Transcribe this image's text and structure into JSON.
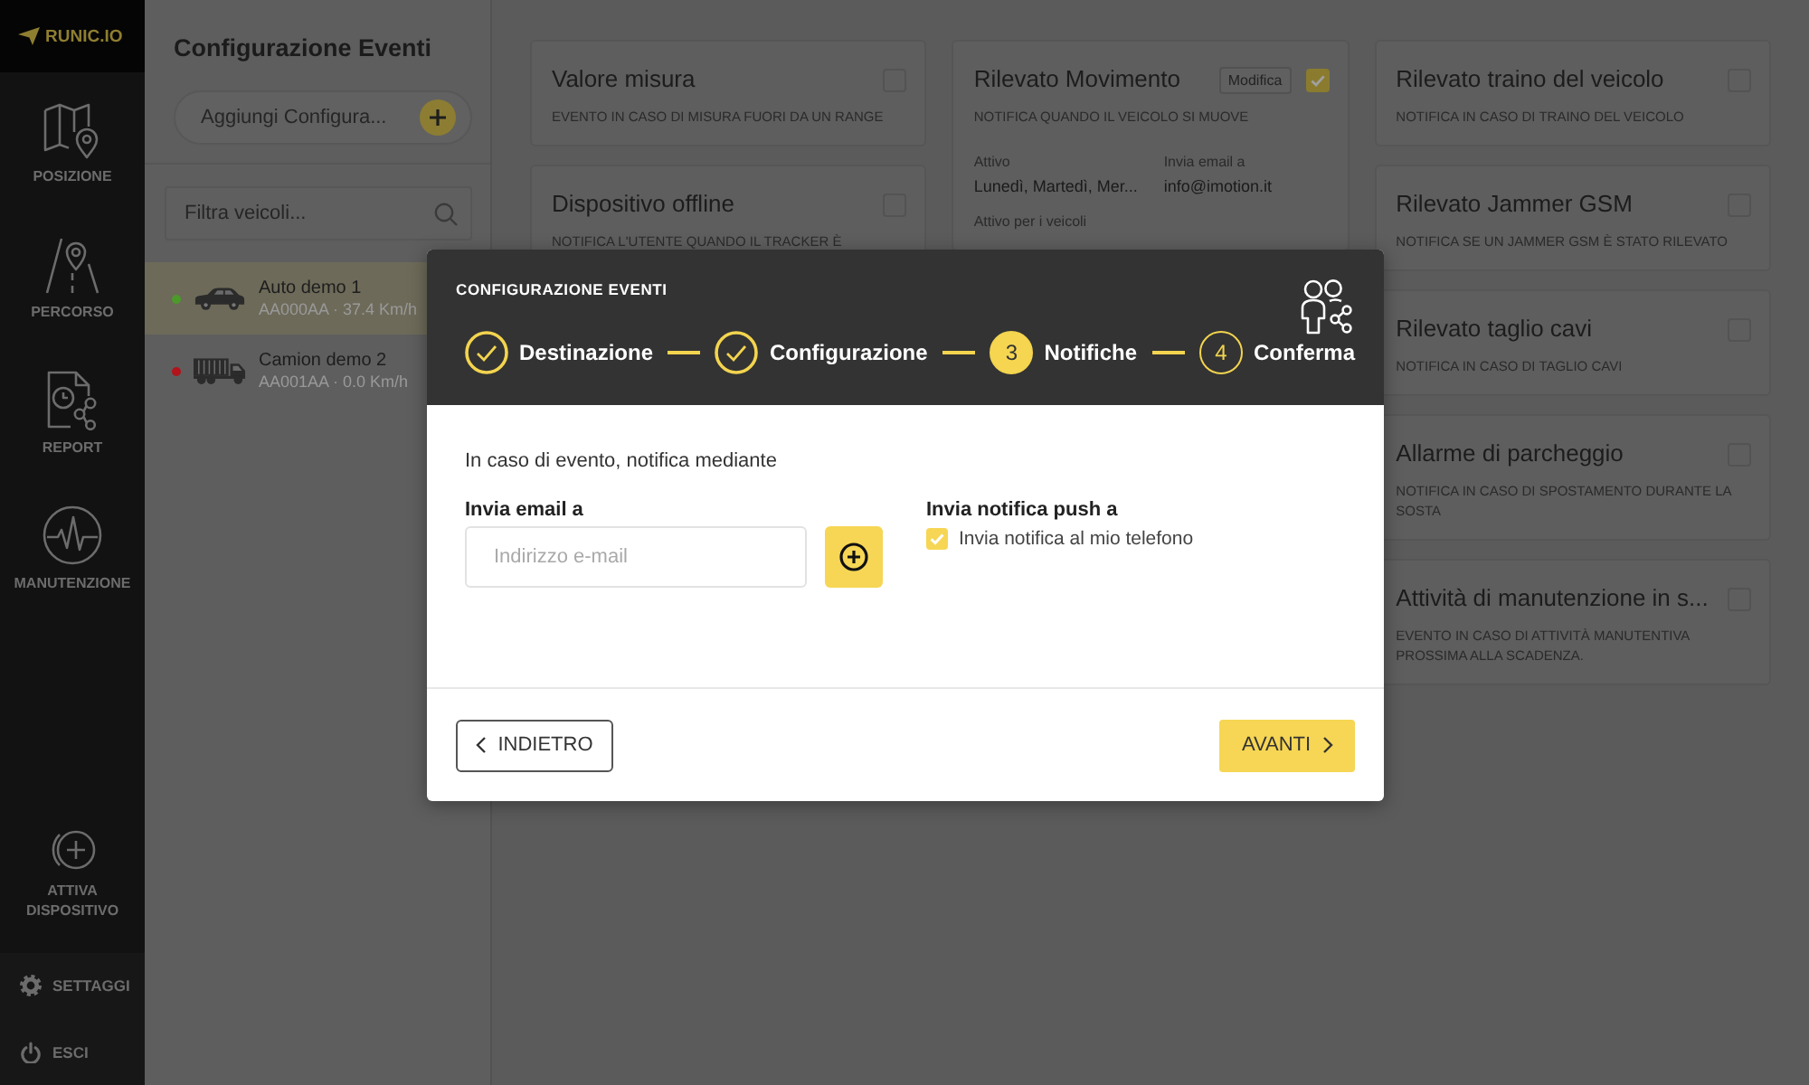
{
  "sidebar": {
    "logo": "RUNIC.IO",
    "items": [
      {
        "label": "POSIZIONE"
      },
      {
        "label": "PERCORSO"
      },
      {
        "label": "REPORT"
      },
      {
        "label": "MANUTENZIONE"
      }
    ],
    "activate": {
      "label": "ATTIVA DISPOSITIVO"
    },
    "footer_items": [
      {
        "label": "SETTAGGI"
      },
      {
        "label": "ESCI"
      }
    ]
  },
  "panel": {
    "title": "Configurazione Eventi",
    "add_button": "Aggiungi Configura...",
    "filter": {
      "placeholder": "Filtra veicoli..."
    },
    "vehicles": [
      {
        "kind": "car",
        "name": "Auto demo 1",
        "detail": "AA000AA · 37.4 Km/h",
        "color": "#4c9a2a",
        "selected": true
      },
      {
        "kind": "truck",
        "name": "Camion demo 2",
        "detail": "AA001AA · 0.0 Km/h",
        "color": "#b3131b",
        "selected": false
      }
    ]
  },
  "event_grid": {
    "columns": [
      {
        "cards": [
          {
            "title": "Valore misura",
            "description": "EVENTO IN CASO DI MISURA FUORI DA UN RANGE",
            "checked": false
          },
          {
            "title": "Dispositivo offline",
            "description": "NOTIFICA L'UTENTE QUANDO IL TRACKER È",
            "checked": false
          }
        ]
      },
      {
        "cards": [
          {
            "title": "Rilevato Movimento",
            "edit_button": "Modifica",
            "description": "NOTIFICA QUANDO IL VEICOLO SI MUOVE",
            "checked": true,
            "details": [
              {
                "label": "Attivo",
                "value": "Lunedì, Martedì, Mer..."
              },
              {
                "label": "Invia email a",
                "value": "info@imotion.it"
              },
              {
                "label": "Attivo per i veicoli"
              }
            ]
          }
        ]
      },
      {
        "cards": [
          {
            "title": "Rilevato traino del veicolo",
            "description": "NOTIFICA IN CASO DI TRAINO DEL VEICOLO",
            "checked": false
          },
          {
            "title": "Rilevato Jammer GSM",
            "description": "NOTIFICA SE UN JAMMER GSM È STATO RILEVATO",
            "checked": false
          },
          {
            "title": "Rilevato taglio cavi",
            "description": "NOTIFICA IN CASO DI TAGLIO CAVI",
            "checked": false
          },
          {
            "title": "Allarme di parcheggio",
            "description": "NOTIFICA IN CASO DI SPOSTAMENTO DURANTE LA SOSTA",
            "checked": false
          },
          {
            "title": "Attività di manutenzione in s...",
            "description": "EVENTO IN CASO DI ATTIVITÀ MANUTENTIVA PROSSIMA ALLA SCADENZA.",
            "checked": false
          }
        ]
      }
    ]
  },
  "modal": {
    "title": "CONFIGURAZIONE EVENTI",
    "steps": [
      {
        "label": "Destinazione",
        "completed": true,
        "current": false
      },
      {
        "label": "Configurazione",
        "completed": true,
        "current": false
      },
      {
        "number": "3",
        "label": "Notifiche",
        "completed": false,
        "current": true
      },
      {
        "number": "4",
        "label": "Conferma",
        "completed": false,
        "current": false
      }
    ],
    "intro": "In caso di evento, notifica mediante",
    "email": {
      "label": "Invia email a",
      "placeholder": "Indirizzo e-mail"
    },
    "push": {
      "label": "Invia notifica push a",
      "option": "Invia notifica al mio telefono",
      "checked": true
    },
    "back_button": "INDIETRO",
    "next_button": "AVANTI"
  }
}
